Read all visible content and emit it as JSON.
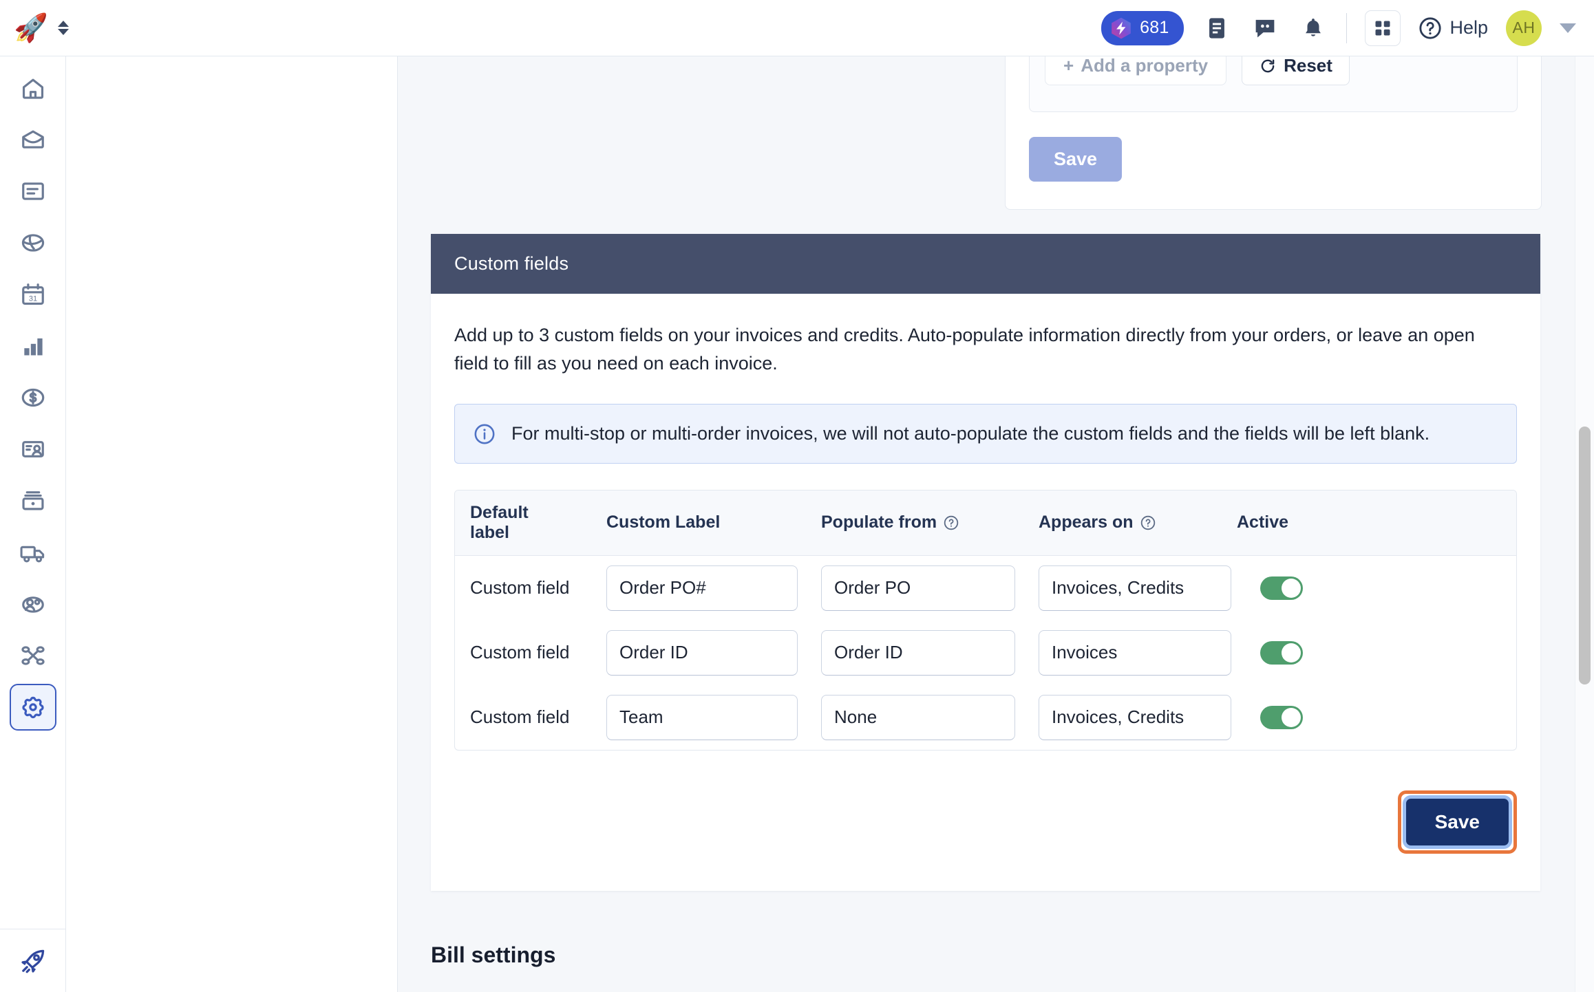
{
  "topbar": {
    "logo_icon": "rocket-logo",
    "switcher_icon": "up-down-chevron-icon",
    "credits": {
      "icon": "lightning-hex-icon",
      "count": "681"
    },
    "icons": [
      {
        "name": "document-icon"
      },
      {
        "name": "chat-bubble-icon"
      },
      {
        "name": "bell-icon"
      },
      {
        "name": "apps-grid-icon"
      }
    ],
    "help": {
      "icon": "question-circle-icon",
      "label": "Help"
    },
    "avatar": {
      "initials": "AH",
      "color": "#d6dd4e"
    },
    "account_caret_icon": "caret-down-icon"
  },
  "sidebar": {
    "items": [
      {
        "name": "home-icon",
        "active": false
      },
      {
        "name": "inbox-icon",
        "active": false
      },
      {
        "name": "document-icon",
        "active": false
      },
      {
        "name": "globe-icon",
        "active": false
      },
      {
        "name": "calendar-icon",
        "active": false
      },
      {
        "name": "bar-chart-icon",
        "active": false
      },
      {
        "name": "dollar-circle-icon",
        "active": false
      },
      {
        "name": "contact-card-icon",
        "active": false
      },
      {
        "name": "archive-tray-icon",
        "active": false
      },
      {
        "name": "truck-icon",
        "active": false
      },
      {
        "name": "people-icon",
        "active": false
      },
      {
        "name": "network-nodes-icon",
        "active": false
      },
      {
        "name": "settings-gear-icon",
        "active": true
      }
    ],
    "footer_icon": "rocket-icon"
  },
  "partial_card": {
    "add_property_label": "Add a property",
    "add_property_icon": "plus-icon",
    "reset_label": "Reset",
    "reset_icon": "refresh-icon",
    "save_label": "Save"
  },
  "custom_fields": {
    "header": "Custom fields",
    "description": "Add up to 3 custom fields on your invoices and credits. Auto-populate information directly from your orders, or leave an open field to fill as you need on each invoice.",
    "note": {
      "icon": "info-circle-icon",
      "text": "For multi-stop or multi-order invoices, we will not auto-populate the custom fields and the fields will be left blank."
    },
    "columns": [
      {
        "label": "Default label",
        "help": false
      },
      {
        "label": "Custom Label",
        "help": false
      },
      {
        "label": "Populate from",
        "help": true
      },
      {
        "label": "Appears on",
        "help": true
      },
      {
        "label": "Active",
        "help": false
      }
    ],
    "rows": [
      {
        "default_label": "Custom field",
        "custom_label": "Order PO#",
        "populate_from": "Order PO",
        "appears_on": "Invoices, Credits",
        "active": true
      },
      {
        "default_label": "Custom field",
        "custom_label": "Order ID",
        "populate_from": "Order ID",
        "appears_on": "Invoices",
        "active": true
      },
      {
        "default_label": "Custom field",
        "custom_label": "Team",
        "populate_from": "None",
        "appears_on": "Invoices, Credits",
        "active": true
      }
    ],
    "save_label": "Save"
  },
  "bill_settings_heading": "Bill settings",
  "colors": {
    "card_header": "#454f6b",
    "accent_blue": "#3454d1",
    "save_primary": "#17316b",
    "toggle_on": "#4f9e6d",
    "highlight_outline": "#e8763c",
    "page_bg": "#f5f7fa"
  }
}
